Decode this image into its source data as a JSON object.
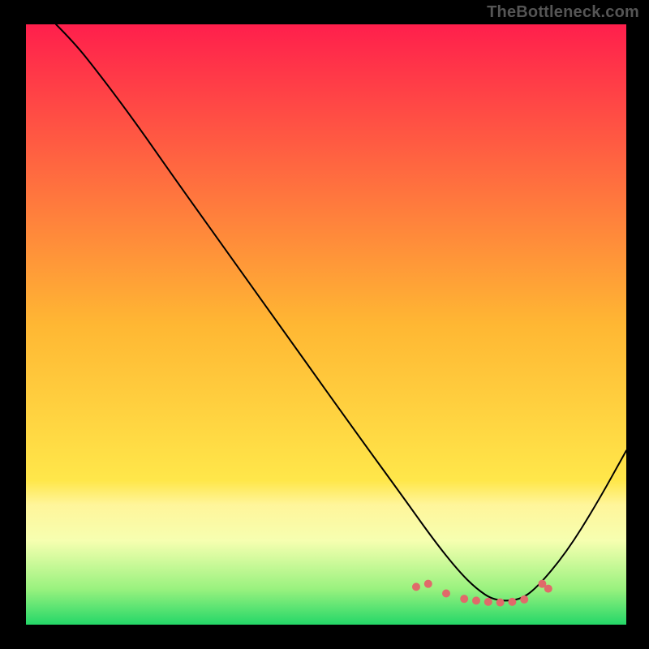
{
  "watermark": "TheBottleneck.com",
  "chart_data": {
    "type": "line",
    "title": "",
    "xlabel": "",
    "ylabel": "",
    "xlim": [
      0,
      100
    ],
    "ylim": [
      0,
      100
    ],
    "grid": false,
    "legend": false,
    "background_gradient_stops": [
      {
        "offset": 0.0,
        "color": "#ff1f4c"
      },
      {
        "offset": 0.5,
        "color": "#ffb733"
      },
      {
        "offset": 0.76,
        "color": "#ffe74a"
      },
      {
        "offset": 0.8,
        "color": "#fff59a"
      },
      {
        "offset": 0.86,
        "color": "#f6ffb0"
      },
      {
        "offset": 0.94,
        "color": "#9af27f"
      },
      {
        "offset": 1.0,
        "color": "#24d768"
      }
    ],
    "series": [
      {
        "name": "bottleneck-curve",
        "color": "#000000",
        "stroke_width": 2,
        "x": [
          5,
          8,
          12,
          18,
          25,
          35,
          45,
          55,
          63,
          68,
          72,
          75,
          78,
          82,
          85,
          90,
          95,
          100
        ],
        "y": [
          100,
          97,
          92,
          84,
          74,
          60,
          46,
          32,
          21,
          14,
          9,
          6,
          4,
          4,
          6,
          12,
          20,
          29
        ]
      }
    ],
    "markers": {
      "name": "optimal-range-markers",
      "color": "#e06a6a",
      "radius": 5,
      "x": [
        65,
        67,
        70,
        73,
        75,
        77,
        79,
        81,
        83,
        86,
        87
      ],
      "y": [
        6.3,
        6.8,
        5.2,
        4.3,
        4.0,
        3.8,
        3.7,
        3.8,
        4.2,
        6.8,
        6.0
      ]
    }
  }
}
